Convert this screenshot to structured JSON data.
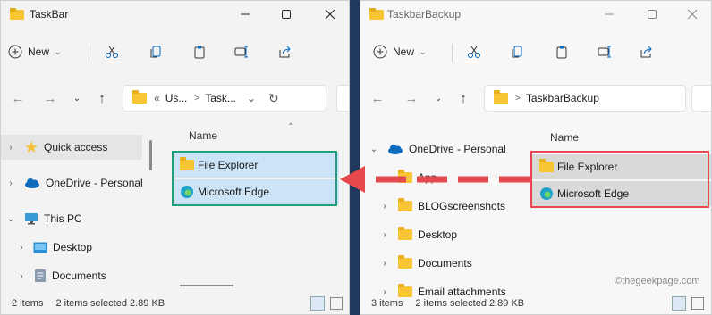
{
  "colors": {
    "highlight_green": "#1f9d7d",
    "highlight_red": "#e5484d",
    "folder": "#f8c534",
    "accent": "#0067c0"
  },
  "left_window": {
    "title": "TaskBar",
    "toolbar": {
      "new_label": "New"
    },
    "address": {
      "crumb_prefix": "«",
      "crumb1": "Us...",
      "crumb2": "Task...",
      "separator": ">"
    },
    "nav": [
      {
        "label": "Quick access",
        "icon": "star-icon"
      },
      {
        "label": "OneDrive - Personal",
        "icon": "cloud-icon"
      },
      {
        "label": "This PC",
        "icon": "monitor-icon"
      },
      {
        "label": "Desktop",
        "icon": "desktop-icon"
      },
      {
        "label": "Documents",
        "icon": "documents-icon"
      }
    ],
    "column_header": "Name",
    "files": [
      {
        "name": "File Explorer",
        "icon": "file-explorer-shortcut-icon"
      },
      {
        "name": "Microsoft Edge",
        "icon": "edge-shortcut-icon"
      }
    ],
    "status": {
      "count": "2 items",
      "selected": "2 items selected  2.89 KB"
    }
  },
  "right_window": {
    "title": "TaskbarBackup",
    "toolbar": {
      "new_label": "New"
    },
    "address": {
      "separator": ">",
      "crumb1": "TaskbarBackup"
    },
    "nav": [
      {
        "label": "OneDrive - Personal",
        "icon": "cloud-icon"
      },
      {
        "label": "App",
        "icon": "folder-icon"
      },
      {
        "label": "BLOGscreenshots",
        "icon": "folder-icon"
      },
      {
        "label": "Desktop",
        "icon": "folder-icon"
      },
      {
        "label": "Documents",
        "icon": "folder-icon"
      },
      {
        "label": "Email attachments",
        "icon": "folder-icon"
      }
    ],
    "column_header": "Name",
    "files": [
      {
        "name": "File Explorer",
        "icon": "file-explorer-shortcut-icon"
      },
      {
        "name": "Microsoft Edge",
        "icon": "edge-shortcut-icon"
      }
    ],
    "status": {
      "count": "3 items",
      "selected": "2 items selected  2.89 KB"
    }
  },
  "watermark": "©thegeekpage.com"
}
